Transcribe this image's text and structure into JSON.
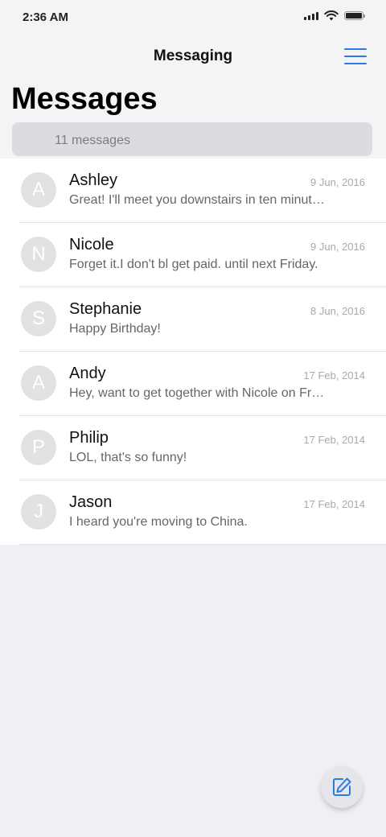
{
  "status_bar": {
    "time": "2:36 AM"
  },
  "nav": {
    "title": "Messaging",
    "menu_icon": "hamburger-menu-icon"
  },
  "header": {
    "large_title": "Messages",
    "count_label": "11 messages"
  },
  "messages": [
    {
      "initial": "A",
      "name": "Ashley",
      "date": "9 Jun, 2016",
      "preview": "Great! I'll meet you downstairs in ten minutes."
    },
    {
      "initial": "N",
      "name": "Nicole",
      "date": "9 Jun, 2016",
      "preview": "Forget it.I don't bl get paid. until next Friday."
    },
    {
      "initial": "S",
      "name": "Stephanie",
      "date": "8 Jun, 2016",
      "preview": "Happy Birthday!"
    },
    {
      "initial": "A",
      "name": "Andy",
      "date": "17 Feb, 2014",
      "preview": "Hey, want to get together with Nicole on Friday?"
    },
    {
      "initial": "P",
      "name": "Philip",
      "date": "17 Feb, 2014",
      "preview": "LOL, that's so funny!"
    },
    {
      "initial": "J",
      "name": "Jason",
      "date": "17 Feb, 2014",
      "preview": "I heard you're moving to China."
    }
  ],
  "compose": {
    "icon": "compose-edit-icon"
  },
  "colors": {
    "accent": "#2a7be4",
    "background": "#efeff4",
    "avatar": "#e2e2e2"
  }
}
